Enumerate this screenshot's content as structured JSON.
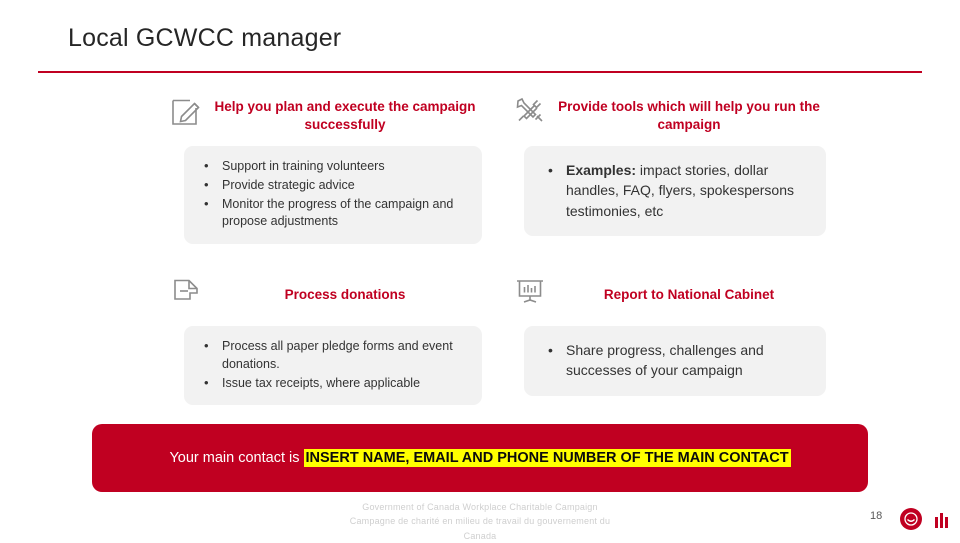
{
  "slide": {
    "title": "Local GCWCC manager",
    "page_number": "18",
    "accent_color": "#c00021",
    "highlight_color": "#ffff00"
  },
  "quadrants": [
    {
      "icon": "pencil-square-icon",
      "heading": "Help you plan and execute the campaign successfully",
      "bullets": [
        "Support in training volunteers",
        "Provide strategic advice",
        "Monitor the progress of the campaign and propose adjustments"
      ]
    },
    {
      "icon": "tools-icon",
      "heading": "Provide tools which will help you run the campaign",
      "bullets_rich": [
        {
          "lead": "Examples:",
          "rest": " impact stories, dollar handles, FAQ, flyers, spokespersons testimonies, etc"
        }
      ]
    },
    {
      "icon": "hand-coin-icon",
      "heading": "Process donations",
      "bullets": [
        "Process all paper pledge forms and event donations.",
        "Issue tax receipts, where applicable"
      ]
    },
    {
      "icon": "presentation-chart-icon",
      "heading": "Report to National Cabinet",
      "bullets": [
        "Share progress, challenges and successes of your campaign"
      ]
    }
  ],
  "banner": {
    "lead_text": "Your main contact is ",
    "highlighted_text": "INSERT NAME, EMAIL AND PHONE NUMBER OF THE MAIN CONTACT"
  },
  "footer": {
    "wordmark_line1": "Government of Canada Workplace Charitable Campaign",
    "wordmark_line2": "Campagne de charité en milieu de travail du gouvernement du Canada"
  }
}
